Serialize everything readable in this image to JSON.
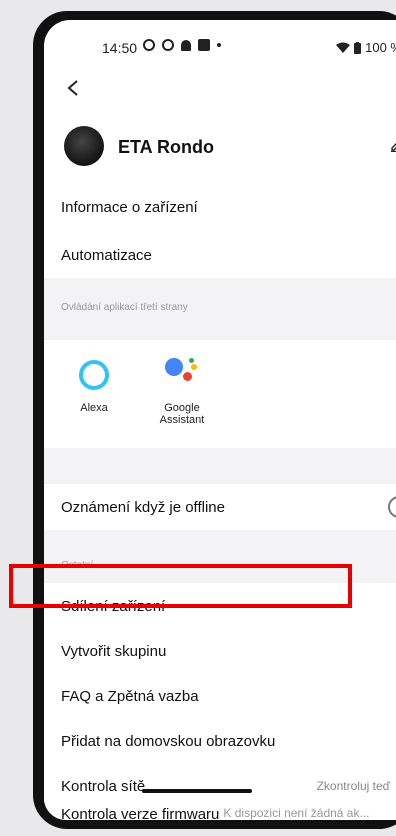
{
  "status_bar": {
    "time": "14:50",
    "battery": "100 %"
  },
  "icons": {
    "back": "back-arrow-icon",
    "edit": "pencil-icon"
  },
  "device": {
    "name": "ETA Rondo"
  },
  "menu": {
    "device_info": "Informace o zařízení",
    "automation": "Automatizace"
  },
  "third_party": {
    "label": "Ovládání aplikací třetí strany",
    "services": [
      {
        "name": "Alexa"
      },
      {
        "name": "Google\nAssistant"
      }
    ]
  },
  "offline_notice": {
    "label": "Oznámení když je offline",
    "enabled": false
  },
  "other": {
    "label": "Ostatní",
    "share": "Sdílení zařízení",
    "create_group": "Vytvořit skupinu",
    "faq": "FAQ a Zpětná vazba",
    "add_home": "Přidat na domovskou obrazovku",
    "network_check": "Kontrola sítě",
    "network_check_value": "Zkontroluj teď",
    "firmware": "Kontrola verze firmwaru",
    "firmware_value": "K dispozici není žádná ak..."
  },
  "colors": {
    "highlight": "#e60000",
    "alexa": "#31c4f3"
  }
}
